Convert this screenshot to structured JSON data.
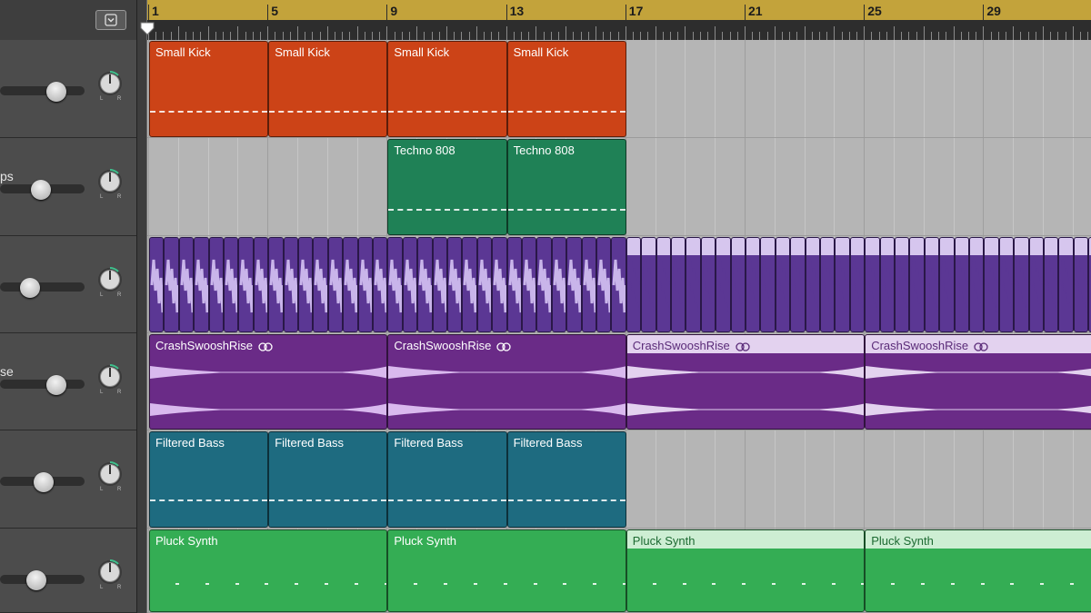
{
  "ruler": {
    "bar_numbers": [
      "1",
      "5",
      "9",
      "13",
      "17",
      "21",
      "25",
      "29"
    ]
  },
  "toolbar": {
    "dropdown_icon": "chevron-down-box-icon"
  },
  "tracks": [
    {
      "name": "",
      "fader_level": 0.67,
      "color": "#cc4317"
    },
    {
      "name": "ps",
      "fader_level": 0.48,
      "color": "#1f8156"
    },
    {
      "name": "",
      "fader_level": 0.35,
      "color": "#5b3794"
    },
    {
      "name": "se",
      "fader_level": 0.67,
      "color": "#6a2b87"
    },
    {
      "name": "",
      "fader_level": 0.52,
      "color": "#1e6b80"
    },
    {
      "name": "",
      "fader_level": 0.43,
      "color": "#34ad54"
    }
  ],
  "pan": {
    "left_label": "L",
    "right_label": "R"
  },
  "regions": {
    "small_kick": [
      "Small Kick",
      "Small Kick",
      "Small Kick",
      "Small Kick"
    ],
    "techno_808": [
      "Techno 808",
      "Techno 808"
    ],
    "crash": [
      "CrashSwooshRise",
      "CrashSwooshRise",
      "CrashSwooshRise",
      "CrashSwooshRise"
    ],
    "filtered_bass": [
      "Filtered Bass",
      "Filtered Bass",
      "Filtered Bass",
      "Filtered Bass"
    ],
    "pluck_synth": [
      "Pluck Synth",
      "Pluck Synth",
      "Pluck Synth",
      "Pluck Synth"
    ]
  }
}
